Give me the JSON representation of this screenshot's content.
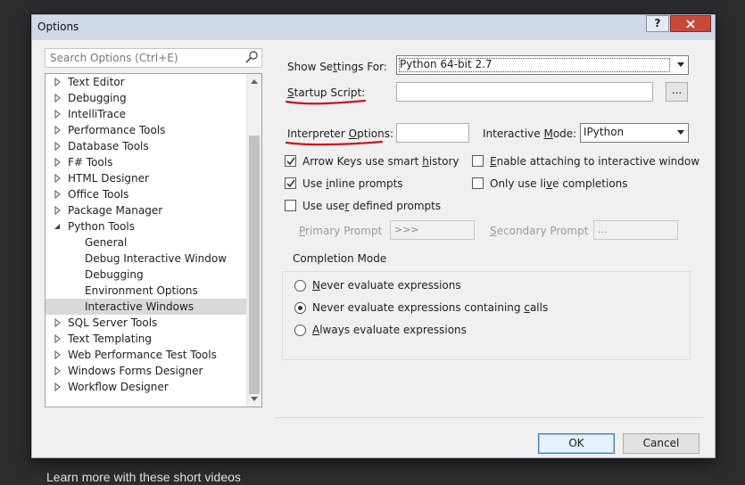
{
  "window": {
    "title": "Options",
    "help_label": "?",
    "close_label": "✕"
  },
  "search": {
    "placeholder": "Search Options (Ctrl+E)"
  },
  "tree": {
    "items": [
      {
        "label": "Text Editor",
        "expandable": true
      },
      {
        "label": "Debugging",
        "expandable": true
      },
      {
        "label": "IntelliTrace",
        "expandable": true
      },
      {
        "label": "Performance Tools",
        "expandable": true
      },
      {
        "label": "Database Tools",
        "expandable": true
      },
      {
        "label": "F# Tools",
        "expandable": true
      },
      {
        "label": "HTML Designer",
        "expandable": true
      },
      {
        "label": "Office Tools",
        "expandable": true
      },
      {
        "label": "Package Manager",
        "expandable": true
      },
      {
        "label": "Python Tools",
        "expandable": true,
        "expanded": true
      },
      {
        "label": "General",
        "child": true
      },
      {
        "label": "Debug Interactive Window",
        "child": true
      },
      {
        "label": "Debugging",
        "child": true
      },
      {
        "label": "Environment Options",
        "child": true
      },
      {
        "label": "Interactive Windows",
        "child": true,
        "selected": true
      },
      {
        "label": "SQL Server Tools",
        "expandable": true
      },
      {
        "label": "Text Templating",
        "expandable": true
      },
      {
        "label": "Web Performance Test Tools",
        "expandable": true
      },
      {
        "label": "Windows Forms Designer",
        "expandable": true
      },
      {
        "label": "Workflow Designer",
        "expandable": true
      }
    ]
  },
  "settings": {
    "show_settings_for_label": "Show Settings For:",
    "show_settings_for_value": "Python 64-bit 2.7",
    "startup_script_label": "Startup Script:",
    "startup_script_value": "",
    "browse_label": "...",
    "interpreter_options_label": "Interpreter Options:",
    "interpreter_options_value": "",
    "interactive_mode_label": "Interactive Mode:",
    "interactive_mode_value": "IPython",
    "arrow_keys_label": "Arrow Keys use smart history",
    "arrow_keys_checked": true,
    "enable_attaching_label": "Enable attaching to interactive window",
    "enable_attaching_checked": false,
    "inline_prompts_label": "Use inline prompts",
    "inline_prompts_checked": true,
    "live_completions_label": "Only use live completions",
    "live_completions_checked": false,
    "user_defined_prompts_label": "Use user defined prompts",
    "user_defined_prompts_checked": false,
    "primary_prompt_label": "Primary Prompt",
    "primary_prompt_value": ">>>",
    "secondary_prompt_label": "Secondary Prompt",
    "secondary_prompt_value": "..."
  },
  "completion_mode": {
    "title": "Completion Mode",
    "options": [
      {
        "label": "Never evaluate expressions",
        "selected": false
      },
      {
        "label": "Never evaluate expressions containing calls",
        "selected": true
      },
      {
        "label": "Always evaluate expressions",
        "selected": false
      }
    ]
  },
  "buttons": {
    "ok_label": "OK",
    "cancel_label": "Cancel"
  },
  "background": {
    "caption": "Learn more with these short videos"
  },
  "colors": {
    "annotation": "#d0121b",
    "title_bar": "#cfd9e8",
    "close": "#c9483c"
  }
}
